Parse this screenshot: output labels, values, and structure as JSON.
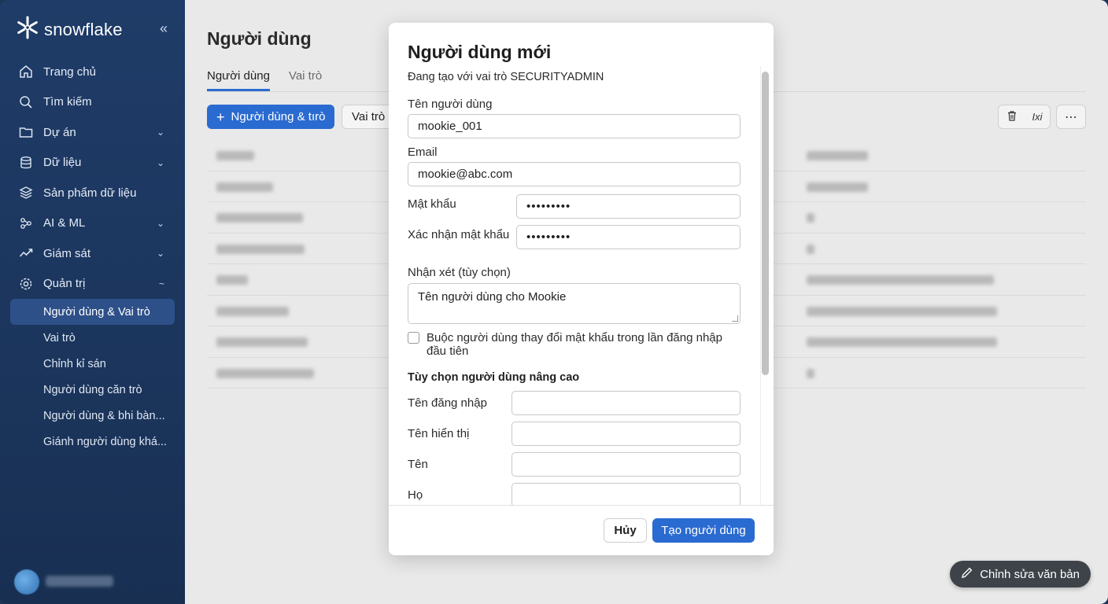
{
  "brand": {
    "name": "snowflake",
    "collapse_icon": "double-chevron-left-icon"
  },
  "sidebar": {
    "items": [
      {
        "label": "Trang chủ",
        "icon": "home-icon",
        "chevron": ""
      },
      {
        "label": "Tìm kiếm",
        "icon": "search-icon",
        "chevron": ""
      },
      {
        "label": "Dự án",
        "icon": "folder-icon",
        "chevron": "⌄"
      },
      {
        "label": "Dữ liệu",
        "icon": "database-icon",
        "chevron": "⌄"
      },
      {
        "label": "Sản phẩm dữ liệu",
        "icon": "layers-icon",
        "chevron": ""
      },
      {
        "label": "AI & ML",
        "icon": "ai-icon",
        "chevron": "⌄"
      },
      {
        "label": "Giám sát",
        "icon": "activity-icon",
        "chevron": "⌄"
      },
      {
        "label": "Quản trị",
        "icon": "gear-icon",
        "chevron": "~"
      }
    ],
    "sub_items": [
      {
        "label": "Người dùng & Vai trò"
      },
      {
        "label": "Vai trò"
      },
      {
        "label": "Chỉnh kỉ sán"
      },
      {
        "label": "Người dùng căn trò"
      },
      {
        "label": "Người dùng & bhi bàn..."
      },
      {
        "label": "Giánh người dùng khá..."
      }
    ]
  },
  "main": {
    "title": "Người dùng",
    "tabs": [
      {
        "label": "Người dùng"
      },
      {
        "label": "Vai trò"
      }
    ],
    "primary_button": "Người dùng & tırò",
    "secondary_button": "Vai trò",
    "tool_text": "Ixi",
    "rows": 8
  },
  "modal": {
    "title": "Người dùng mới",
    "subtitle": "Đang tạo với vai trò SECURITYADMIN",
    "username_label": "Tên người dùng",
    "username_value": "mookie_001",
    "email_label": "Email",
    "email_value": "mookie@abc.com",
    "password_label": "Mật khẩu",
    "password_value": "•••••••••",
    "confirm_label": "Xác nhận mật khẩu",
    "confirm_value": "•••••••••",
    "comment_label": "Nhận xét (tùy chọn)",
    "comment_value": "Tên người dùng cho Mookie",
    "force_change_label": "Buộc người dùng thay đổi mật khẩu trong lần đăng nhập đầu tiên",
    "advanced_title": "Tùy chọn người dùng nâng cao",
    "login_label": "Tên đăng nhập",
    "display_label": "Tên hiển thị",
    "first_label": "Tên",
    "last_label": "Họ",
    "cancel": "Hủy",
    "create": "Tạo người dùng"
  },
  "edit_pill": "Chỉnh sửa văn bản"
}
